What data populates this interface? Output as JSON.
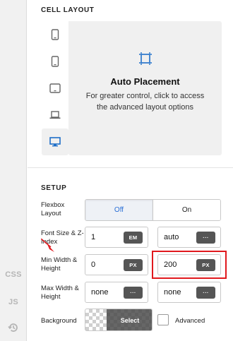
{
  "rail": {
    "css": "CSS",
    "js": "JS",
    "history_icon": "history-icon"
  },
  "cell_layout": {
    "title": "CELL LAYOUT",
    "devices": [
      "phone-portrait-icon",
      "phone-landscape-icon",
      "tablet-icon",
      "laptop-icon",
      "desktop-icon"
    ],
    "active_device": "desktop",
    "placement_title": "Auto Placement",
    "placement_desc": "For greater control, click to access the advanced layout options"
  },
  "setup": {
    "title": "SETUP",
    "flexbox": {
      "label": "Flexbox Layout",
      "off": "Off",
      "on": "On",
      "selected": "Off"
    },
    "font_size": {
      "label": "Font Size & Z-Index",
      "value": "1",
      "unit": "EM",
      "zindex": "auto",
      "more": "···"
    },
    "min_size": {
      "label": "Min Width & Height",
      "width": "0",
      "width_unit": "PX",
      "height": "200",
      "height_unit": "PX"
    },
    "max_size": {
      "label": "Max Width & Height",
      "width": "none",
      "height": "none",
      "more": "···"
    },
    "background": {
      "label": "Background",
      "select": "Select",
      "advanced": "Advanced"
    }
  },
  "annotation": {
    "highlight_color": "#e0181d"
  }
}
